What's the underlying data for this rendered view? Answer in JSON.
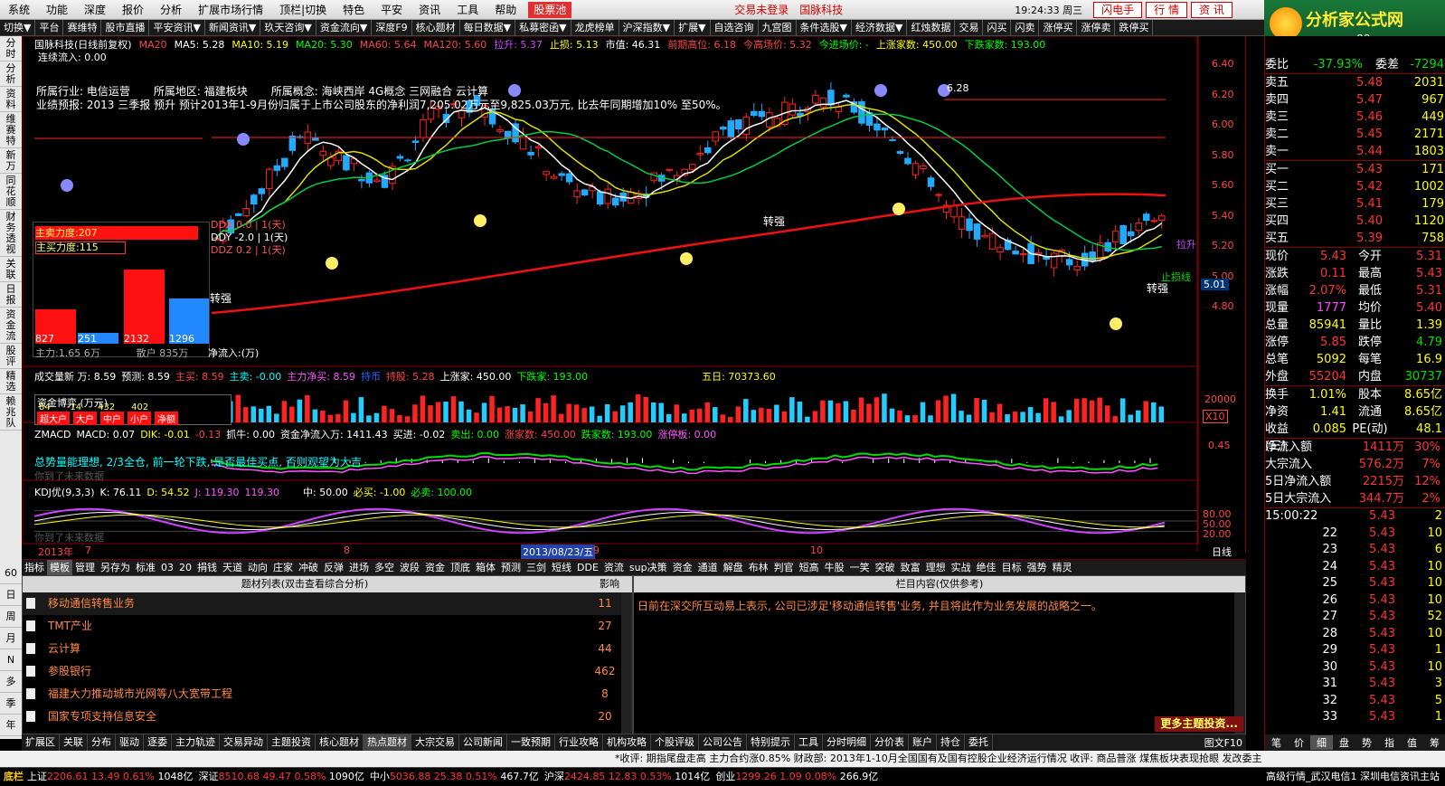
{
  "menu": [
    "系统",
    "功能",
    "深度",
    "报价",
    "分析",
    "扩展市场行情",
    "顶栏|切换",
    "特色",
    "平安",
    "资讯",
    "工具",
    "帮助"
  ],
  "menu_badge": "股票池",
  "menu_status": "交易未登录",
  "menu_broker": "国脉科技",
  "clock": "19:24:33 周三",
  "top_buttons": [
    "闪电手",
    "行 情",
    "资 讯"
  ],
  "toolbar": [
    "切换▼",
    "平台",
    "赛维特",
    "股市直播",
    "平安资讯▼",
    "新闻资讯▼",
    "玖天咨询▼",
    "资金流向▼",
    "深度F9",
    "核心题材",
    "每日数据▼",
    "私募密函▼",
    "龙虎榜单",
    "沪深指数▼",
    "扩展▼",
    "自选咨询",
    "九宫图",
    "条件选股▼",
    "经济数据▼",
    "红烛数据",
    "交易",
    "闪买",
    "闪卖",
    "涨停买",
    "涨停卖",
    "跌停买"
  ],
  "logo": {
    "title": "分析家公式网",
    "url": "www.88gs.com"
  },
  "leftbar": [
    "分时",
    "分析",
    "资料",
    "维赛特",
    "新万",
    "同花顺",
    "财务透视",
    "关联",
    "日报",
    "资金流",
    "股评",
    "精选",
    "赖兆队"
  ],
  "leftbar2": [
    "60",
    "日",
    "周",
    "月",
    "N",
    "多",
    "季",
    "年"
  ],
  "chart": {
    "header": [
      "国脉科技(日线前复权)",
      "MA20",
      "MA5: 5.28",
      "MA10: 5.19",
      "MA20: 5.30",
      "MA60: 5.64",
      "MA120: 5.60",
      "拉升: 5.37",
      "止损: 5.13",
      "市值: 46.31",
      "前期高位: 6.18",
      "今高场价: 5.32",
      "今进场价: -",
      "上涨家数: 450.00",
      "下跌家数: 193.00"
    ],
    "flow": "连续流入: 0.00",
    "industry": "所属行业: 电信运营",
    "region": "所属地区: 福建板块",
    "concept": "所属概念: 海峡西岸 4G概念 三网融合 云计算",
    "forecast": "业绩预报: 2013 三季报 预升 预计2013年1-9月份归属于上市公司股东的净利润7,205.02万元至9,825.03万元, 比去年同期增加10% 至50%。",
    "high_label": "6.28",
    "low_label": "5.01",
    "signal_labels": [
      "转强",
      "转强",
      "转强",
      "拉升",
      "止损线"
    ],
    "price_axis": [
      "6.40",
      "6.20",
      "6.00",
      "5.80",
      "5.60",
      "5.40",
      "5.20",
      "5.00",
      "4.80"
    ],
    "strength": {
      "main": "主卖力度:207",
      "sub": "主买力度:115",
      "vals": [
        "827",
        "251",
        "2132",
        "1296"
      ],
      "foot1": "主力:1.65 6万",
      "foot2": "散户 835万",
      "net": "净流入:(万)"
    },
    "ddx": [
      "DDX 0.0 | 1(天)",
      "DDY -2.0 | 1(天)",
      "DDZ 0.2 | 1(天)"
    ],
    "vol_header": [
      "成交量新 万: 8.59",
      "预测: 8.59",
      "主买: 8.59",
      "主卖: -0.00",
      "主力净买: 8.59",
      "持币",
      "持股: 5.28",
      "上涨家: 450.00",
      "下跌家: 193.00",
      "五日: 70373.60"
    ],
    "vol_axis": "20000",
    "vol_unit": "X10",
    "fund_box": [
      "资金博弈 (万元)",
      "84",
      "-14",
      "432",
      "402",
      "超大户",
      "大户",
      "中户",
      "小户",
      "净额"
    ],
    "macd_header": [
      "ZMACD",
      "MACD: 0.07",
      "DIK: -0.01",
      "-0.13",
      "抓牛: 0.00",
      "资金净流入万: 1411.43",
      "买进: -0.02",
      "卖出: 0.00",
      "涨家数: 450.00",
      "跌家数: 193.00",
      "涨停板: 0.00"
    ],
    "macd_axis": "0.45",
    "macd_note": "总势量能理想, 2/3全仓, 前一轮下跌, 是否最佳买点, 否则观望为大吉",
    "macd_note2": "你到了未来数据",
    "kdj_header": [
      "KDJ优(9,3,3)",
      "K: 76.11",
      "D: 54.52",
      "J: 119.30",
      "119.30",
      "中: 50.00",
      "必买: -1.00",
      "必卖: 100.00"
    ],
    "kdj_axis": [
      "80.00",
      "50.00",
      "20.00"
    ],
    "kdj_note": "你到了未来数据",
    "date_axis": [
      "2013年",
      "7",
      "8",
      "2013/08/23/五",
      "9",
      "10",
      "11",
      "日线"
    ]
  },
  "tabs": [
    "指标",
    "模板",
    "管理",
    "另存为",
    "标准",
    "03",
    "20",
    "捐钱",
    "天道",
    "动向",
    "庄家",
    "冲破",
    "反弹",
    "进场",
    "多空",
    "波段",
    "资金",
    "顶底",
    "箱体",
    "预测",
    "三剑",
    "短线",
    "DDE",
    "资流",
    "sup决策",
    "资金",
    "通道",
    "解盘",
    "布林",
    "判官",
    "短高",
    "牛股",
    "一笑",
    "突破",
    "致富",
    "理想",
    "实战",
    "绝佳",
    "目标",
    "强势",
    "精灵"
  ],
  "topics": {
    "header": "题材列表(双击查看综合分析)",
    "impact": "影响",
    "rows": [
      {
        "name": "移动通信转售业务",
        "val": "11"
      },
      {
        "name": "TMT产业",
        "val": "27"
      },
      {
        "name": "云计算",
        "val": "44"
      },
      {
        "name": "参股银行",
        "val": "462"
      },
      {
        "name": "福建大力推动城市光网等八大宽带工程",
        "val": "8"
      },
      {
        "name": "国家专项支持信息安全",
        "val": "20"
      }
    ]
  },
  "content": {
    "header": "栏目内容(仅供参考)",
    "text": "日前在深交所互动易上表示, 公司已涉足'移动通信转售'业务, 并且将此作为业务发展的战略之一。",
    "more": "更多主题投资..."
  },
  "bottomnav": [
    "扩展区",
    "关联",
    "分布",
    "驱动",
    "逐委",
    "主力轨迹",
    "交易异动",
    "主题投资",
    "核心题材",
    "热点题材",
    "大宗交易",
    "公司新闻",
    "一致预期",
    "行业攻略",
    "机构攻略",
    "个股评级",
    "公司公告",
    "特别提示",
    "工具",
    "分时明细",
    "分价表",
    "账户",
    "持仓",
    "委托"
  ],
  "bottomnav_right": "图文F10",
  "right_tabs": [
    "笔",
    "价",
    "细",
    "盘",
    "势",
    "指",
    "值",
    "筹"
  ],
  "ticker": "*收评: 期指尾盘走高 主力合约涨0.85%   财政部: 2013年1-10月全国国有及国有控股企业经济运行情况   收评: 商品普涨 煤焦板块表现抢眼   发改委主",
  "status": {
    "label": "底栏",
    "items": [
      {
        "n": "上证",
        "v": "2206.61",
        "c": "13.49",
        "p": "0.61%",
        "a": "1048亿"
      },
      {
        "n": "深证",
        "v": "8510.68",
        "c": "49.47",
        "p": "0.58%",
        "a": "1090亿"
      },
      {
        "n": "中小",
        "v": "5036.88",
        "c": "25.38",
        "p": "0.51%",
        "a": "467.7亿"
      },
      {
        "n": "沪深",
        "v": "2424.85",
        "c": "12.83",
        "p": "0.53%",
        "a": "1014亿"
      },
      {
        "n": "创业",
        "v": "1299.26",
        "c": "1.09",
        "p": "0.08%",
        "a": "266.9亿"
      }
    ],
    "right": "高级行情_武汉电信1  深圳电信资讯主站"
  },
  "quote": {
    "wb": {
      "k": "委比",
      "v": "-37.93%",
      "k2": "委差",
      "w": "-7294"
    },
    "asks": [
      {
        "k": "卖五",
        "v": "5.48",
        "w": "2031"
      },
      {
        "k": "卖四",
        "v": "5.47",
        "w": "967"
      },
      {
        "k": "卖三",
        "v": "5.46",
        "w": "449"
      },
      {
        "k": "卖二",
        "v": "5.45",
        "w": "2171"
      },
      {
        "k": "卖一",
        "v": "5.44",
        "w": "1803"
      }
    ],
    "bids": [
      {
        "k": "买一",
        "v": "5.43",
        "w": "171"
      },
      {
        "k": "买二",
        "v": "5.42",
        "w": "1002"
      },
      {
        "k": "买三",
        "v": "5.41",
        "w": "179"
      },
      {
        "k": "买四",
        "v": "5.40",
        "w": "1120"
      },
      {
        "k": "买五",
        "v": "5.39",
        "w": "758"
      }
    ],
    "info": [
      {
        "k": "现价",
        "v": "5.43",
        "k2": "今开",
        "w": "5.31"
      },
      {
        "k": "涨跌",
        "v": "0.11",
        "k2": "最高",
        "w": "5.43"
      },
      {
        "k": "涨幅",
        "v": "2.07%",
        "k2": "最低",
        "w": "5.31"
      },
      {
        "k": "现量",
        "v": "1777",
        "k2": "均价",
        "w": "5.40"
      },
      {
        "k": "总量",
        "v": "85941",
        "k2": "量比",
        "w": "1.39"
      },
      {
        "k": "涨停",
        "v": "5.85",
        "k2": "跌停",
        "w": "4.79"
      },
      {
        "k": "总笔",
        "v": "5092",
        "k2": "每笔",
        "w": "16.9"
      },
      {
        "k": "外盘",
        "v": "55204",
        "k2": "内盘",
        "w": "30737"
      }
    ],
    "info2": [
      {
        "k": "换手",
        "v": "1.01%",
        "k2": "股本",
        "w": "8.65亿"
      },
      {
        "k": "净资",
        "v": "1.41",
        "k2": "流通",
        "w": "8.65亿"
      },
      {
        "k": "收益(三)",
        "v": "0.085",
        "k2": "PE(动)",
        "w": "48.1"
      }
    ],
    "flows": [
      {
        "k": "净流入额",
        "v": "1411万",
        "w": "30%"
      },
      {
        "k": "大宗流入",
        "v": "576.2万",
        "w": "7%"
      },
      {
        "k": "5日净流入额",
        "v": "2215万",
        "w": "12%"
      },
      {
        "k": "5日大宗流入",
        "v": "344.7万",
        "w": "2%"
      }
    ],
    "ticks": [
      {
        "t": "15:00:22",
        "p": "5.43",
        "v": "2"
      },
      {
        "t": "22",
        "p": "5.43",
        "v": "10"
      },
      {
        "t": "23",
        "p": "5.43",
        "v": "6"
      },
      {
        "t": "24",
        "p": "5.43",
        "v": "10"
      },
      {
        "t": "25",
        "p": "5.43",
        "v": "10"
      },
      {
        "t": "26",
        "p": "5.43",
        "v": "10"
      },
      {
        "t": "27",
        "p": "5.43",
        "v": "52"
      },
      {
        "t": "28",
        "p": "5.43",
        "v": "10"
      },
      {
        "t": "29",
        "p": "5.43",
        "v": "1"
      },
      {
        "t": "30",
        "p": "5.43",
        "v": "10"
      },
      {
        "t": "31",
        "p": "5.43",
        "v": "3"
      },
      {
        "t": "32",
        "p": "5.43",
        "v": "5"
      },
      {
        "t": "33",
        "p": "5.43",
        "v": "1"
      }
    ]
  },
  "colors": {
    "up": "#ff2222",
    "down": "#22aaff",
    "ma5": "#ffffff",
    "ma10": "#dddd00",
    "ma20": "#00cc44",
    "ma60": "#ff2222",
    "frame": "#880000"
  }
}
